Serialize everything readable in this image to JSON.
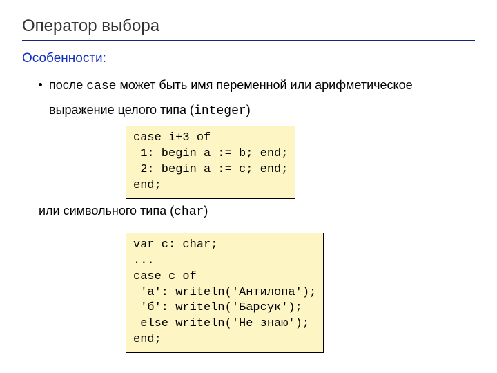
{
  "title": "Оператор выбора",
  "subtitle": "Особенности:",
  "bullet1": {
    "pre": "после ",
    "kw": "case",
    "post": " может быть имя переменной или арифметическое выражение целого типа (",
    "type1": "integer",
    "close": ")"
  },
  "code1": "case i+3 of\n 1: begin a := b; end;\n 2: begin a := c; end;\nend;",
  "line2": {
    "pre": "или символьного типа (",
    "type2": "char",
    "close": ")"
  },
  "code2": "var c: char;\n...\ncase c of\n 'а': writeln('Антилопа');\n 'б': writeln('Барсук');\n else writeln('Не знаю');\nend;"
}
